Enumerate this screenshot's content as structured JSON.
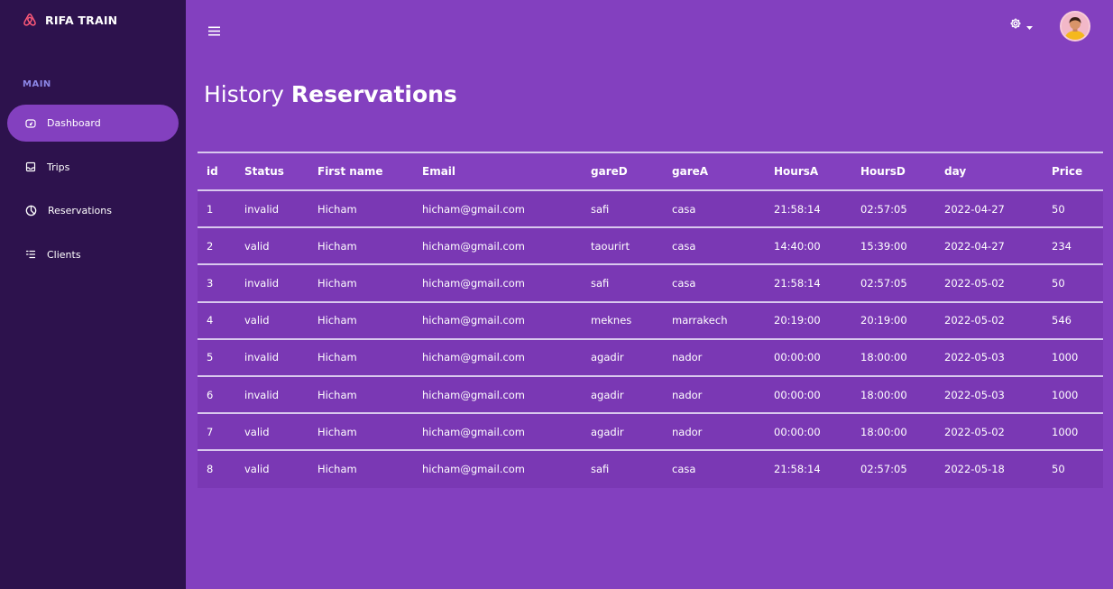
{
  "brand": {
    "name": "RIFA TRAIN",
    "icon": "airbnb-logo-icon",
    "icon_color": "#ff5a79"
  },
  "sidebar": {
    "section_label": "MAIN",
    "items": [
      {
        "label": "Dashboard",
        "icon": "dashboard-gauge-icon",
        "active": true
      },
      {
        "label": "Trips",
        "icon": "inbox-tray-icon",
        "active": false
      },
      {
        "label": "Reservations",
        "icon": "pie-chart-icon",
        "active": false
      },
      {
        "label": "Clients",
        "icon": "list-icon",
        "active": false
      }
    ]
  },
  "topbar": {
    "menu_icon": "hamburger-icon",
    "settings_icon": "gear-icon",
    "caret_icon": "caret-down-icon"
  },
  "page": {
    "title_light": "History",
    "title_bold": "Reservations"
  },
  "colors": {
    "sidebar_bg": "#2d124d",
    "main_bg": "#8340bf",
    "row_bg": "#7a38b4",
    "section_label": "#8c86e6"
  },
  "table": {
    "columns": [
      "id",
      "Status",
      "First name",
      "Email",
      "gareD",
      "gareA",
      "HoursA",
      "HoursD",
      "day",
      "Price"
    ],
    "rows": [
      [
        "1",
        "invalid",
        "Hicham",
        "hicham@gmail.com",
        "safi",
        "casa",
        "21:58:14",
        "02:57:05",
        "2022-04-27",
        "50"
      ],
      [
        "2",
        "valid",
        "Hicham",
        "hicham@gmail.com",
        "taourirt",
        "casa",
        "14:40:00",
        "15:39:00",
        "2022-04-27",
        "234"
      ],
      [
        "3",
        "invalid",
        "Hicham",
        "hicham@gmail.com",
        "safi",
        "casa",
        "21:58:14",
        "02:57:05",
        "2022-05-02",
        "50"
      ],
      [
        "4",
        "valid",
        "Hicham",
        "hicham@gmail.com",
        "meknes",
        "marrakech",
        "20:19:00",
        "20:19:00",
        "2022-05-02",
        "546"
      ],
      [
        "5",
        "invalid",
        "Hicham",
        "hicham@gmail.com",
        "agadir",
        "nador",
        "00:00:00",
        "18:00:00",
        "2022-05-03",
        "1000"
      ],
      [
        "6",
        "invalid",
        "Hicham",
        "hicham@gmail.com",
        "agadir",
        "nador",
        "00:00:00",
        "18:00:00",
        "2022-05-03",
        "1000"
      ],
      [
        "7",
        "valid",
        "Hicham",
        "hicham@gmail.com",
        "agadir",
        "nador",
        "00:00:00",
        "18:00:00",
        "2022-05-02",
        "1000"
      ],
      [
        "8",
        "valid",
        "Hicham",
        "hicham@gmail.com",
        "safi",
        "casa",
        "21:58:14",
        "02:57:05",
        "2022-05-18",
        "50"
      ]
    ]
  }
}
